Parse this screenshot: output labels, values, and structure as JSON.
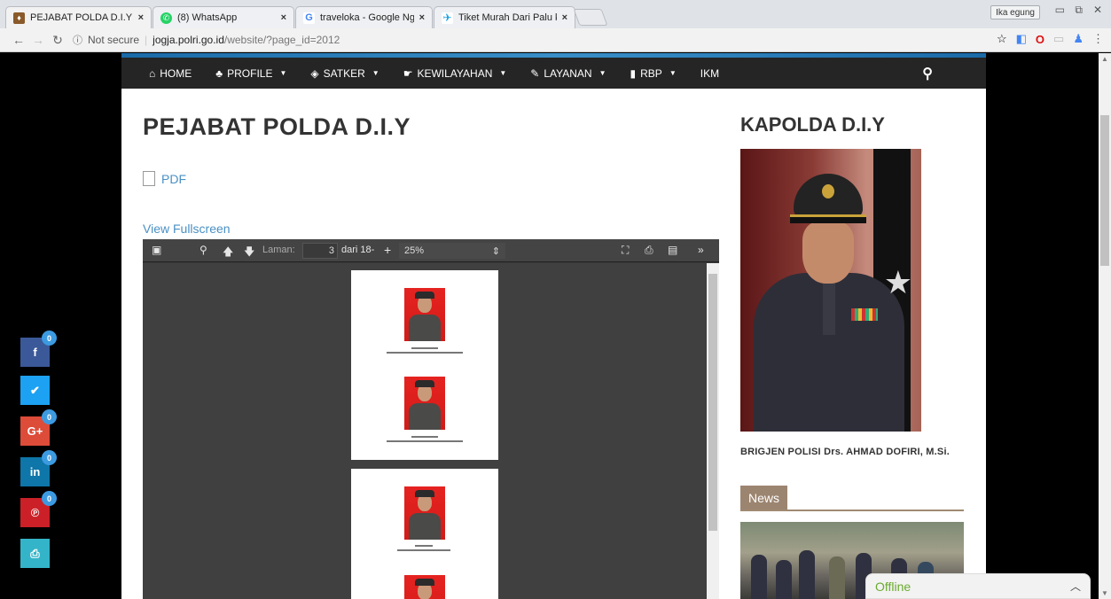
{
  "browser": {
    "tabs": [
      {
        "title": "PEJABAT POLDA D.I.Y – P",
        "favicon_color": "#8a5a2a",
        "active": true
      },
      {
        "title": "(8) WhatsApp",
        "favicon_color": "#25d366",
        "active": false
      },
      {
        "title": "traveloka - Google Nggo",
        "favicon_color": "#4285f4",
        "active": false
      },
      {
        "title": "Tiket Murah Dari Palu ke",
        "favicon_color": "#1ba0e2",
        "active": false
      }
    ],
    "close_glyph": "×",
    "user_badge": "Ika egung",
    "address": {
      "security": "Not secure",
      "host": "jogja.polri.go.id",
      "path": "/website/?page_id=2012"
    }
  },
  "site": {
    "nav": [
      {
        "label": "HOME",
        "icon": "home-icon",
        "glyph": "⌂",
        "caret": false
      },
      {
        "label": "PROFILE",
        "icon": "sitemap-icon",
        "glyph": "♣",
        "caret": true
      },
      {
        "label": "SATKER",
        "icon": "shield-icon",
        "glyph": "◈",
        "caret": true
      },
      {
        "label": "KEWILAYAHAN",
        "icon": "thumbs-up-icon",
        "glyph": "☛",
        "caret": true
      },
      {
        "label": "LAYANAN",
        "icon": "edit-icon",
        "glyph": "✎",
        "caret": true
      },
      {
        "label": "RBP",
        "icon": "book-icon",
        "glyph": "▮",
        "caret": true
      },
      {
        "label": "IKM",
        "icon": "",
        "glyph": "",
        "caret": false
      }
    ],
    "page_title": "PEJABAT POLDA D.I.Y",
    "pdf_link": "PDF",
    "view_fullscreen": "View Fullscreen",
    "viewer": {
      "page_label": "Laman:",
      "page_number": "3",
      "page_total": "dari 18-",
      "zoom": "25%"
    },
    "sidebar": {
      "title": "KAPOLDA D.I.Y",
      "caption": "BRIGJEN POLISI Drs. AHMAD DOFIRI, M.Si.",
      "news_label": "News"
    },
    "share": [
      {
        "name": "facebook",
        "glyph": "f",
        "color": "#3b5998",
        "count": "0"
      },
      {
        "name": "twitter",
        "glyph": "✔",
        "color": "#1da1f2",
        "count": ""
      },
      {
        "name": "google-plus",
        "glyph": "G+",
        "color": "#dd4b39",
        "count": "0"
      },
      {
        "name": "linkedin",
        "glyph": "in",
        "color": "#0e76a8",
        "count": "0"
      },
      {
        "name": "pinterest",
        "glyph": "℗",
        "color": "#cb2027",
        "count": "0"
      },
      {
        "name": "print",
        "glyph": "⎙",
        "color": "#34b4c8",
        "count": ""
      }
    ],
    "chat": {
      "status": "Offline"
    }
  }
}
